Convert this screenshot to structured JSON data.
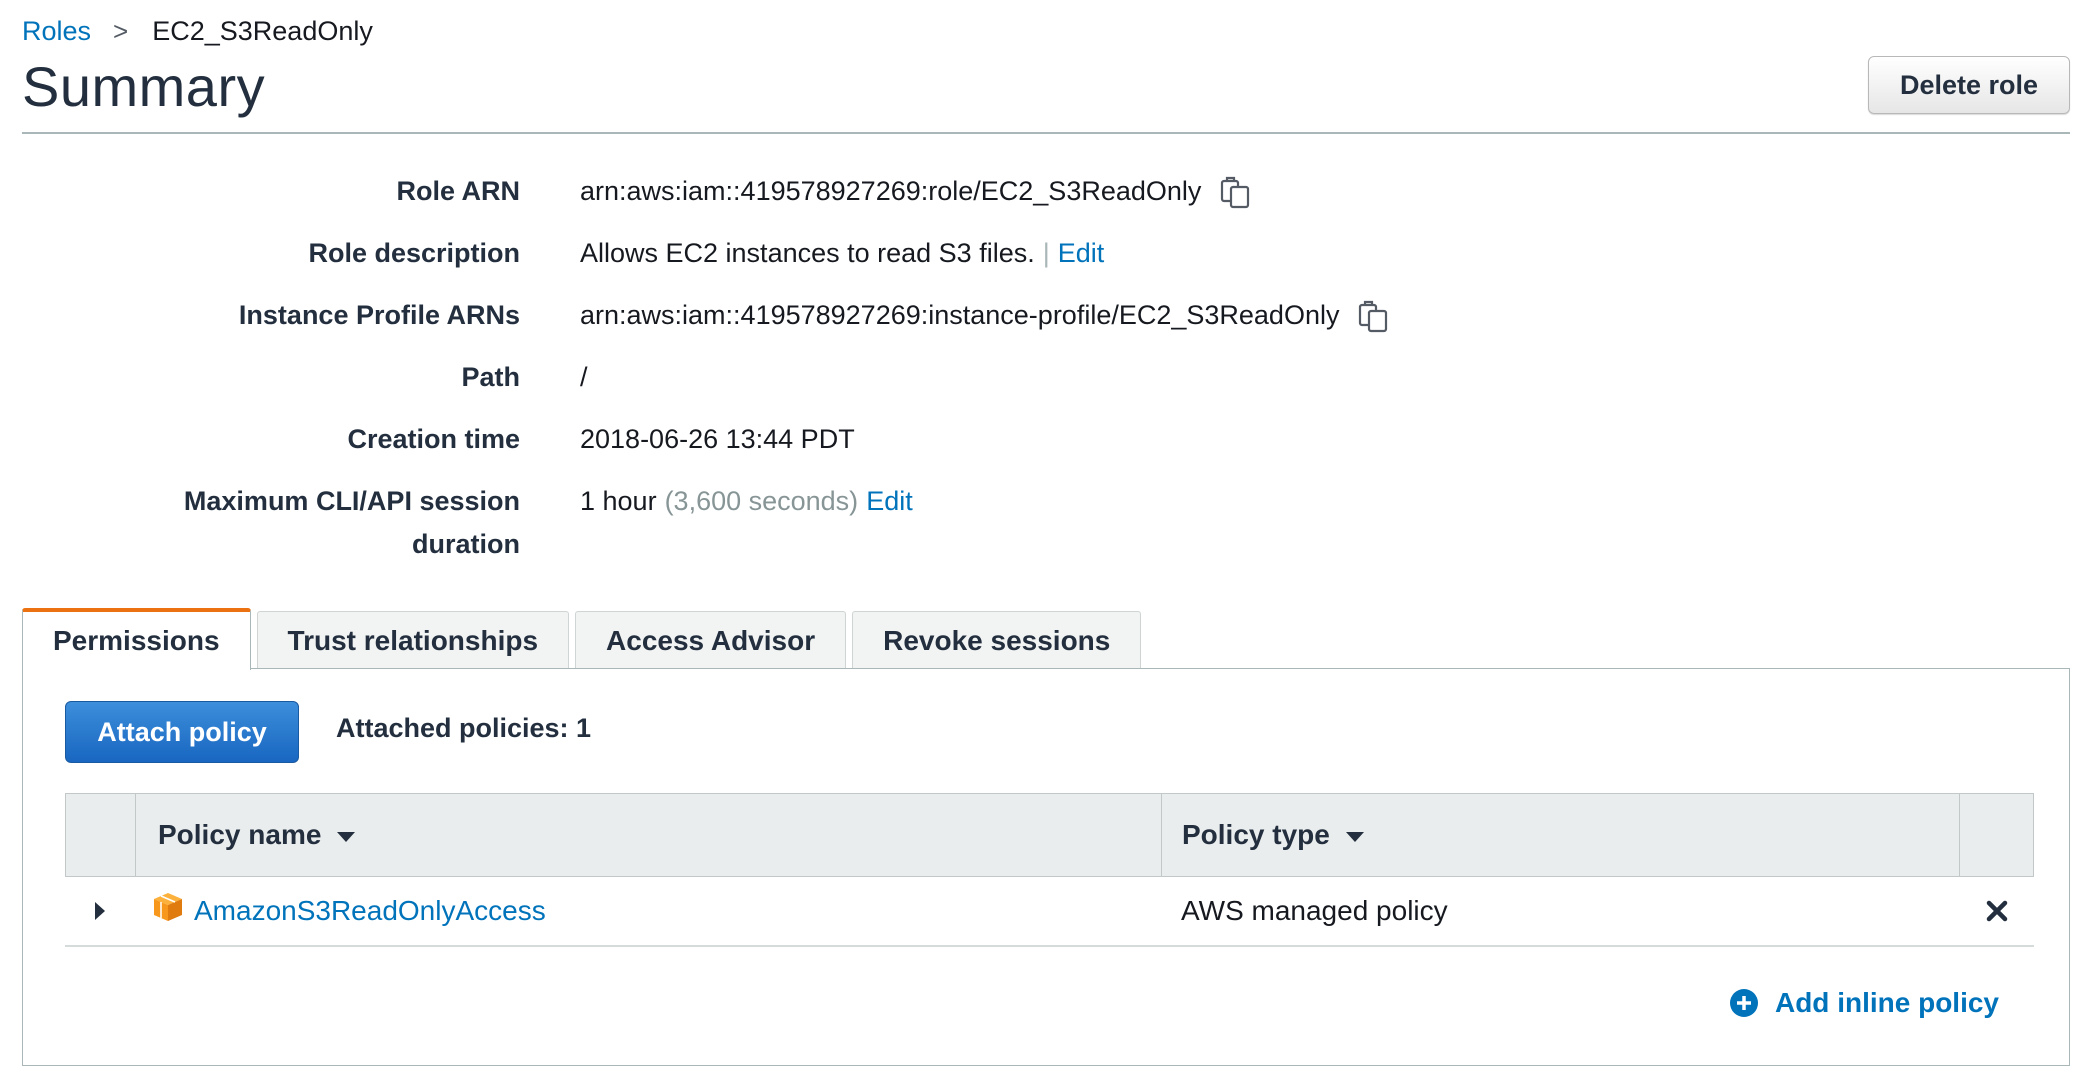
{
  "breadcrumb": {
    "parent": "Roles",
    "separator": ">",
    "current": "EC2_S3ReadOnly"
  },
  "header": {
    "title": "Summary",
    "delete_button": "Delete role"
  },
  "details": {
    "role_arn": {
      "label": "Role ARN",
      "value": "arn:aws:iam::419578927269:role/EC2_S3ReadOnly"
    },
    "role_description": {
      "label": "Role description",
      "value": "Allows EC2 instances to read S3 files.",
      "separator": "|",
      "edit": "Edit"
    },
    "instance_profile_arns": {
      "label": "Instance Profile ARNs",
      "value": "arn:aws:iam::419578927269:instance-profile/EC2_S3ReadOnly"
    },
    "path": {
      "label": "Path",
      "value": "/"
    },
    "creation_time": {
      "label": "Creation time",
      "value": "2018-06-26 13:44 PDT"
    },
    "max_session": {
      "label_line1": "Maximum CLI/API session",
      "label_line2": "duration",
      "value": "1 hour",
      "seconds": "(3,600 seconds)",
      "edit": "Edit"
    }
  },
  "tabs": [
    {
      "label": "Permissions",
      "active": true
    },
    {
      "label": "Trust relationships",
      "active": false
    },
    {
      "label": "Access Advisor",
      "active": false
    },
    {
      "label": "Revoke sessions",
      "active": false
    }
  ],
  "permissions": {
    "attach_button": "Attach policy",
    "attached_count": "Attached policies: 1",
    "columns": {
      "policy_name": "Policy name",
      "policy_type": "Policy type"
    },
    "rows": [
      {
        "name": "AmazonS3ReadOnlyAccess",
        "type": "AWS managed policy"
      }
    ],
    "add_inline": "Add inline policy"
  },
  "colors": {
    "link": "#0073bb",
    "active_tab_accent": "#ec7211",
    "primary_button": "#1866c1",
    "policy_icon": "#f7981d"
  },
  "icons": {
    "copy": "copy-icon",
    "expand": "caret-right-icon",
    "sort": "caret-down-icon",
    "policy": "aws-box-icon",
    "remove": "close-icon",
    "add": "plus-circle-icon"
  }
}
